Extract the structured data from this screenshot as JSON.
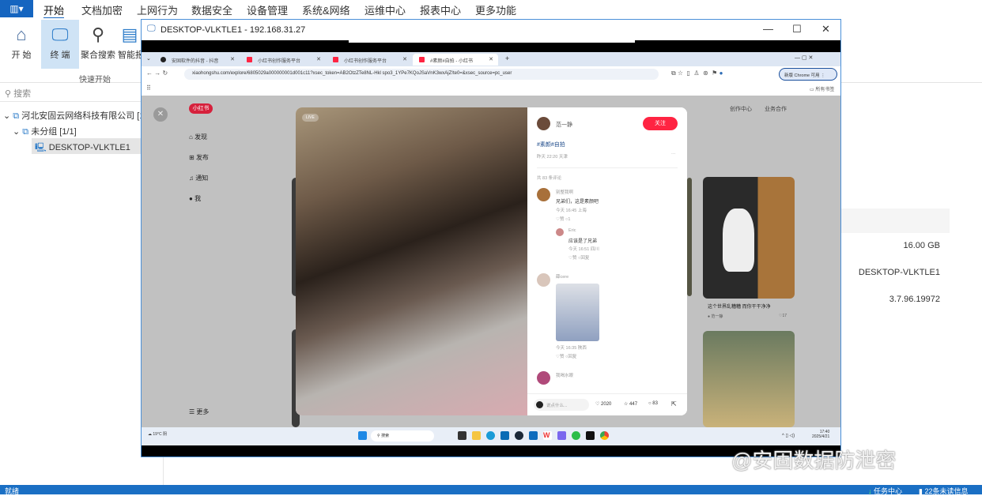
{
  "app": {
    "menu_icon": "app-menu-icon",
    "menus": [
      "开始",
      "文档加密",
      "上网行为",
      "数据安全",
      "设备管理",
      "系统&网络",
      "运维中心",
      "报表中心",
      "更多功能"
    ],
    "ribbon": [
      {
        "label": "开 始",
        "icon": "home-icon"
      },
      {
        "label": "终 端",
        "icon": "terminal-icon"
      },
      {
        "label": "聚合搜索",
        "icon": "search-icon"
      },
      {
        "label": "智能报",
        "icon": "report-icon"
      }
    ],
    "group_label": "快速开始",
    "search_placeholder": "搜索",
    "tree": [
      "河北安固云网络科技有限公司 [1/1]",
      "未分组 [1/1]",
      "DESKTOP-VLKTLE1"
    ],
    "details": [
      "16.00 GB",
      "DESKTOP-VLKTLE1",
      "3.7.96.19972"
    ],
    "status": {
      "left": "就绪",
      "task_center": "任务中心",
      "unread": "22条未读信息"
    }
  },
  "remote": {
    "title": "DESKTOP-VLKTLE1 - 192.168.31.27",
    "tabs": [
      "安固软件的抖音 - 抖音",
      "小红书创作服务平台",
      "小红书创作服务平台",
      "#素颜#自拍 - 小红书"
    ],
    "url": "xiaohongshu.com/explore/6805029a000000001d001c11?xsec_token=AB2OtzZTe8NL-Hkl spo3_1YPe7KQoJSaVnK3wxAjZ!te0=&xsec_source=pc_user",
    "chrome_button": "新版 Chrome 可用",
    "bookmarks": "所有书签",
    "xhs": {
      "logo": "小红书",
      "nav": [
        "发现",
        "发布",
        "通知",
        "我"
      ],
      "more": "更多",
      "top_nav": [
        "创作中心",
        "业务合作"
      ],
      "live": "LIVE",
      "author": "范一静",
      "follow": "关注",
      "tags": "#素颜#自拍",
      "post_time": "昨天 22:20 天津",
      "comment_count": "共 83 条评论",
      "comments": [
        {
          "user": "别整我啊",
          "text": "兄弟们，这是素颜吧",
          "meta": "今天 16:45 上海",
          "like": "赞",
          "reply": "1"
        },
        {
          "user": "Eric",
          "text": "应该是了兄弟",
          "meta": "今天 16:51 四川",
          "like": "赞",
          "reply": "回复"
        },
        {
          "user": "薛cere",
          "text": "",
          "meta": "今天 16:35 陕西",
          "like": "赞",
          "reply": "回复"
        },
        {
          "user": "我喝水眼",
          "text": "",
          "meta": ""
        }
      ],
      "input_placeholder": "说点什么...",
      "likes": "2020",
      "stars": "447",
      "comments_total": "83",
      "card": {
        "title": "这个世界乱糟糟 而你干干净净",
        "author": "范一静",
        "likes": "17"
      }
    },
    "taskbar": {
      "weather": "19°C 阴",
      "search": "搜索",
      "time": "17:40",
      "date": "2025/4/21"
    }
  },
  "watermark": "@安固数据防泄密"
}
